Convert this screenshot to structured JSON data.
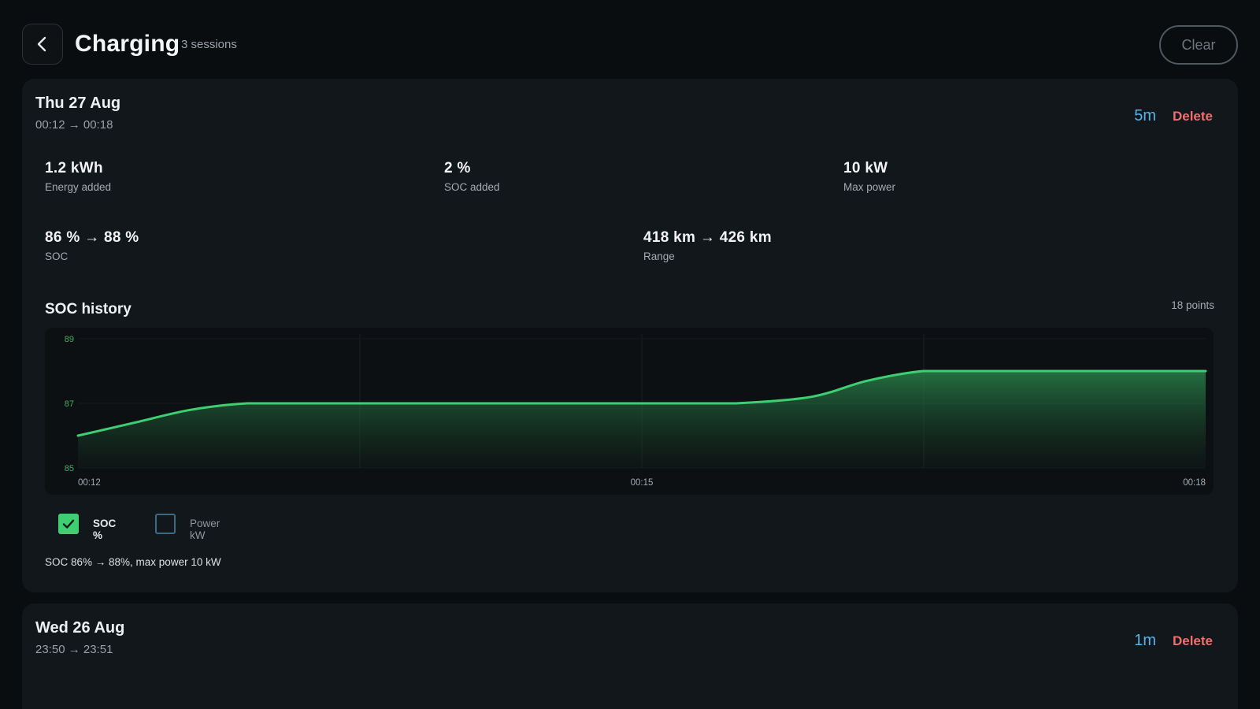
{
  "header": {
    "title": "Charging",
    "subtitle": "3 sessions",
    "clear_label": "Clear"
  },
  "sessions": [
    {
      "date": "Thu 27 Aug",
      "time_range": "00:12 → 00:18",
      "duration": "5m",
      "delete_label": "Delete",
      "stats": {
        "energy": {
          "value": "1.2 kWh",
          "label": "Energy added"
        },
        "soc_added": {
          "value": "2 %",
          "label": "SOC added"
        },
        "max_power": {
          "value": "10 kW",
          "label": "Max power"
        },
        "soc": {
          "value": "86 % → 88 %",
          "label": "SOC"
        },
        "range": {
          "value": "418 km → 426 km",
          "label": "Range"
        }
      },
      "history": {
        "title": "SOC history",
        "points_label": "18 points",
        "legend": {
          "soc_label": "SOC %",
          "soc_checked": true,
          "power_label": "Power kW",
          "power_checked": false
        },
        "summary": "SOC 86% → 88%, max power 10 kW"
      }
    },
    {
      "date": "Wed 26 Aug",
      "time_range": "23:50 → 23:51",
      "duration": "1m",
      "delete_label": "Delete"
    }
  ],
  "chart_data": {
    "type": "area",
    "title": "SOC history",
    "xlabel": "",
    "ylabel": "",
    "x_ticks": [
      "00:12",
      "00:15",
      "00:18"
    ],
    "y_ticks": [
      85,
      87,
      89
    ],
    "ylim": [
      85,
      89
    ],
    "xlim_minutes": [
      0,
      6
    ],
    "series": [
      {
        "name": "SOC %",
        "color": "#3fcf72",
        "points": [
          [
            0.0,
            86.0
          ],
          [
            0.3,
            86.4
          ],
          [
            0.6,
            86.8
          ],
          [
            0.9,
            87.0
          ],
          [
            1.2,
            87.0
          ],
          [
            1.6,
            87.0
          ],
          [
            2.0,
            87.0
          ],
          [
            2.4,
            87.0
          ],
          [
            2.8,
            87.0
          ],
          [
            3.2,
            87.0
          ],
          [
            3.5,
            87.0
          ],
          [
            3.9,
            87.2
          ],
          [
            4.2,
            87.7
          ],
          [
            4.5,
            88.0
          ],
          [
            4.8,
            88.0
          ],
          [
            5.2,
            88.0
          ],
          [
            5.6,
            88.0
          ],
          [
            6.0,
            88.0
          ]
        ]
      }
    ],
    "grid": true,
    "legend": "bottom-left"
  }
}
